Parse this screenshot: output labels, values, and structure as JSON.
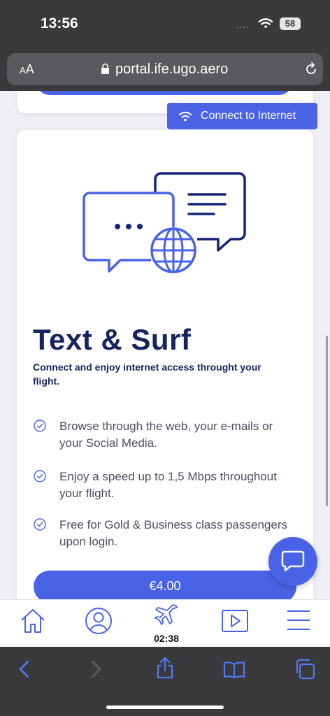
{
  "status_bar": {
    "time": "13:56",
    "signal": "....",
    "battery": "58"
  },
  "url_bar": {
    "aa_small": "A",
    "aa_large": "A",
    "url": "portal.ife.ugo.aero"
  },
  "connect_pill": {
    "label": "Connect to Internet"
  },
  "card": {
    "title": "Text & Surf",
    "subtitle": "Connect and enjoy internet access throught your flight.",
    "features": [
      "Browse through the web, your e-mails or your Social Media.",
      "Enjoy a speed up to 1,5 Mbps throughout your flight.",
      "Free for Gold & Business class passengers upon login."
    ],
    "price_button": "€4.00"
  },
  "app_nav": {
    "flight_time": "02:38"
  },
  "colors": {
    "accent": "#4a63e6",
    "navy": "#14245e",
    "browser_chrome": "#3a3a3c"
  },
  "icons": [
    "wifi-icon",
    "lock-icon",
    "reload-icon",
    "chat-illustration",
    "globe-icon",
    "check-icon",
    "chat-bubble-icon",
    "home-icon",
    "profile-icon",
    "plane-icon",
    "play-icon",
    "menu-icon",
    "back-icon",
    "forward-icon",
    "share-icon",
    "bookmarks-icon",
    "tabs-icon"
  ]
}
